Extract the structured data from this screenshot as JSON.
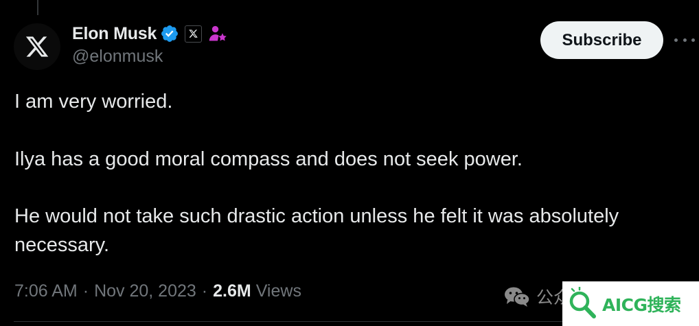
{
  "author": {
    "display_name": "Elon Musk",
    "handle": "@elonmusk",
    "avatar_icon": "x-logo-icon",
    "verified_icon": "verified-badge-icon",
    "affiliation_icon": "x-affiliation-badge-icon",
    "subscriber_icon": "subscriber-badge-icon"
  },
  "actions": {
    "subscribe_label": "Subscribe",
    "more_icon": "more-options-icon"
  },
  "tweet": {
    "paragraphs": [
      "I am very worried.",
      "Ilya has a good moral compass and does not seek power.",
      "He would not take such drastic action unless he felt it was absolutely necessary."
    ]
  },
  "meta": {
    "time": "7:06 AM",
    "separator": "·",
    "date": "Nov 20, 2023",
    "views_count": "2.6M",
    "views_label": "Views"
  },
  "watermark": {
    "wechat_icon": "wechat-icon",
    "wechat_text": "公众",
    "logo_text": "AICG搜索",
    "logo_icon": "magnifier-icon"
  },
  "colors": {
    "background": "#000000",
    "primary_text": "#e7e9ea",
    "secondary_text": "#71767b",
    "verified_blue": "#1d9bf0",
    "subscriber_pink": "#c936cc",
    "subscribe_bg": "#eff3f4",
    "logo_green": "#2fb35a"
  }
}
